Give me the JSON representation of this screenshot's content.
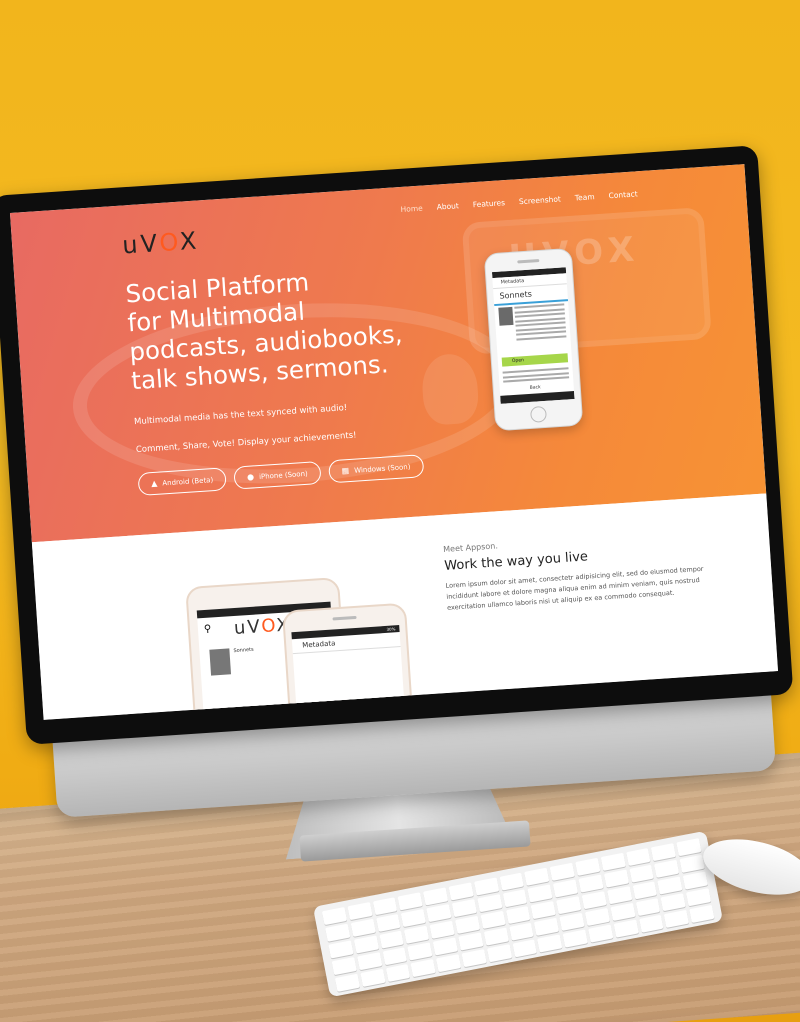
{
  "site": {
    "logo": {
      "prefix": "uV",
      "o": "O",
      "suffix": "X"
    },
    "nav": [
      "Home",
      "About",
      "Features",
      "Screenshot",
      "Team",
      "Contact"
    ],
    "hero": {
      "headline_lines": [
        "Social Platform",
        "for Multimodal",
        "podcasts, audiobooks,",
        "talk shows, sermons."
      ],
      "tagline": "Multimodal media has the text synced with audio!",
      "tagline2": "Comment, Share, Vote! Display your achievements!",
      "buttons": [
        {
          "label": "Android (Beta)",
          "icon": "android-icon"
        },
        {
          "label": "iPhone (Soon)",
          "icon": "apple-icon"
        },
        {
          "label": "Windows (Soon)",
          "icon": "windows-icon"
        }
      ],
      "bg_logo": "UVOX"
    },
    "phone_screen": {
      "header": "Metadata",
      "title": "Sonnets",
      "open_label": "Open",
      "back_label": "Back"
    },
    "lower": {
      "eyebrow": "Meet Appson.",
      "title": "Work the way you live",
      "body": "Lorem ipsum dolor sit amet, consectetr adipisicing elit, sed do eiusmod tempor incididunt labore et dolore magna aliqua enim ad minim veniam, quis nostrud exercitation ullamco laboris nisi ut aliquip ex ea commodo consequat.",
      "phone2_item": "Sonnets",
      "phone3_header": "Metadata",
      "phone3_status": "30%"
    }
  },
  "colors": {
    "hero_start": "#e86a62",
    "hero_end": "#f79334",
    "logo_accent": "#ff5a1f",
    "background_yellow": "#f2b51c"
  }
}
